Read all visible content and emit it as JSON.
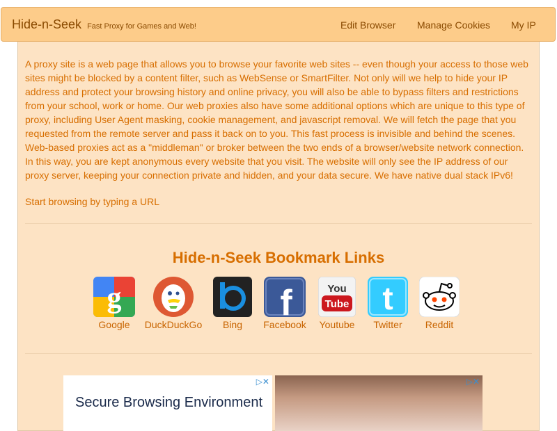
{
  "navbar": {
    "brand": "Hide-n-Seek",
    "tagline": "Fast Proxy for Games and Web!",
    "items": [
      {
        "label": "Edit Browser"
      },
      {
        "label": "Manage Cookies"
      },
      {
        "label": "My IP"
      }
    ]
  },
  "main": {
    "intro": "A proxy site is a web page that allows you to browse your favorite web sites -- even though your access to those web sites might be blocked by a content filter, such as WebSense or SmartFilter. Not only will we help to hide your IP address and protect your browsing history and online privacy, you will also be able to bypass filters and restrictions from your school, work or home. Our web proxies also have some additional options which are unique to this type of proxy, including User Agent masking, cookie management, and javascript removal. We will fetch the page that you requested from the remote server and pass it back on to you. This fast process is invisible and behind the scenes. Web-based proxies act as a \"middleman\" or broker between the two ends of a browser/website network connection. In this way, you are kept anonymous every website that you visit. The website will only see the IP address of our proxy server, keeping your connection private and hidden, and your data secure. We have native dual stack IPv6!",
    "start_text": "Start browsing by typing a URL"
  },
  "bookmarks": {
    "title": "Hide-n-Seek Bookmark Links",
    "items": [
      {
        "label": "Google",
        "icon": "google-icon"
      },
      {
        "label": "DuckDuckGo",
        "icon": "duckduckgo-icon"
      },
      {
        "label": "Bing",
        "icon": "bing-icon"
      },
      {
        "label": "Facebook",
        "icon": "facebook-icon"
      },
      {
        "label": "Youtube",
        "icon": "youtube-icon"
      },
      {
        "label": "Twitter",
        "icon": "twitter-icon"
      },
      {
        "label": "Reddit",
        "icon": "reddit-icon"
      }
    ]
  },
  "ads": {
    "ad1_headline": "Secure Browsing Environment"
  },
  "colors": {
    "navbar_bg": "#fdcc8a",
    "panel_bg": "#fde3c4",
    "text": "#d76e00"
  }
}
